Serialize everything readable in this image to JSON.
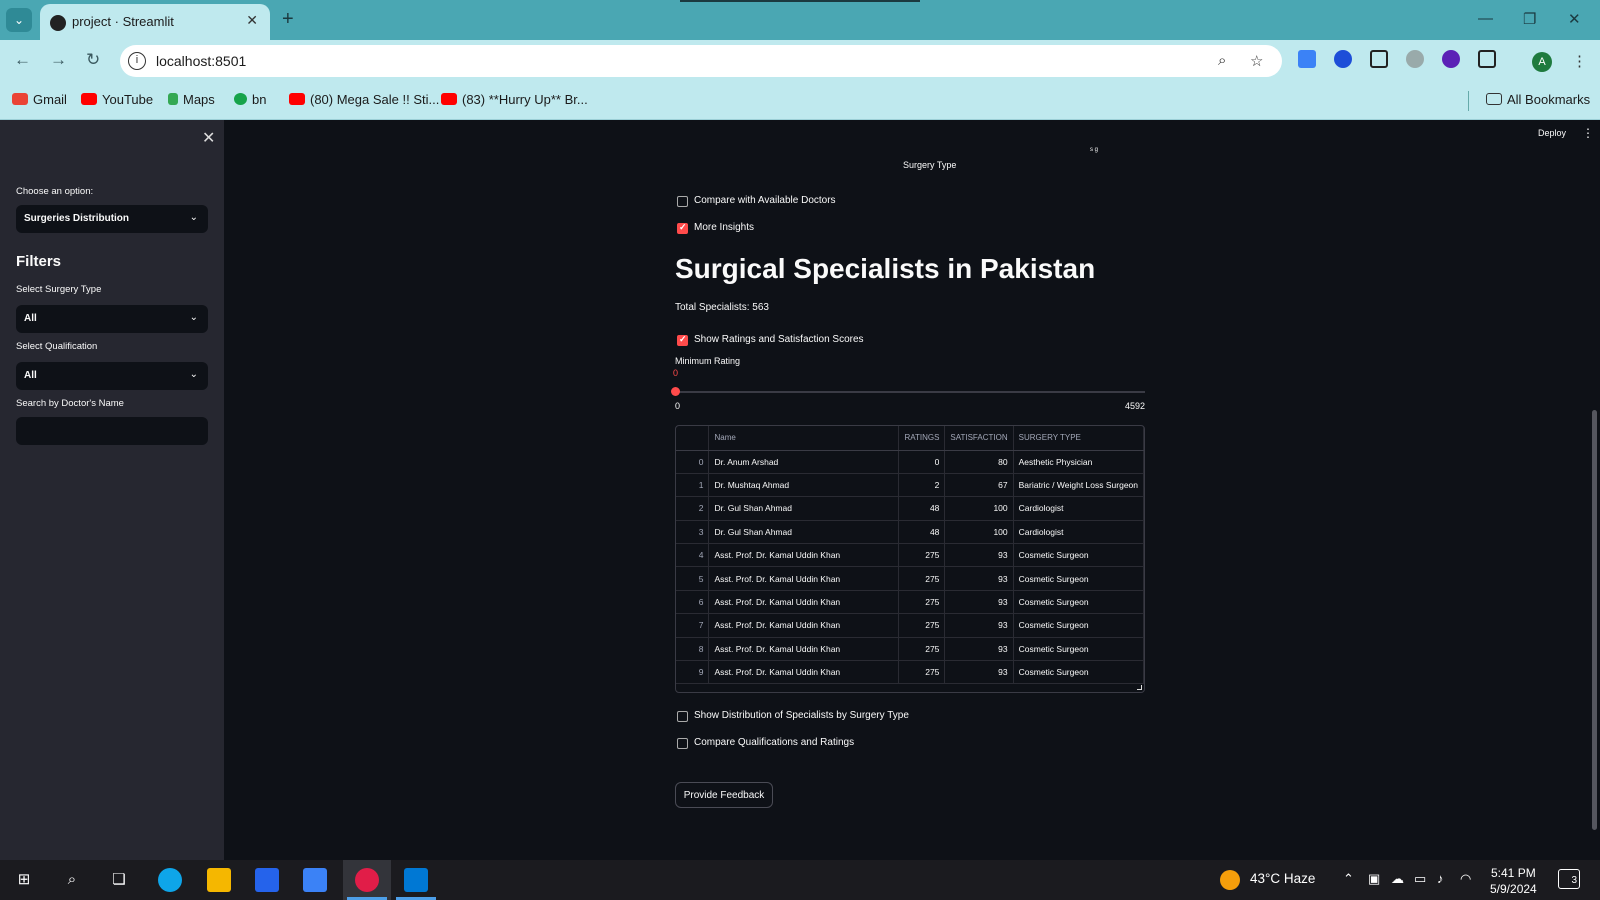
{
  "browser": {
    "tab_title": "project · Streamlit",
    "url": "localhost:8501",
    "bookmarks": [
      "Gmail",
      "YouTube",
      "Maps",
      "bn",
      "(80) Mega Sale !! Sti...",
      "(83) **Hurry Up** Br..."
    ],
    "all_bookmarks": "All Bookmarks",
    "profile_initial": "A"
  },
  "sidebar": {
    "choose_label": "Choose an option:",
    "choose_value": "Surgeries Distribution",
    "filters_heading": "Filters",
    "surgery_type_label": "Select Surgery Type",
    "surgery_type_value": "All",
    "qualification_label": "Select Qualification",
    "qualification_value": "All",
    "search_label": "Search by Doctor's Name",
    "search_value": ""
  },
  "header": {
    "deploy": "Deploy"
  },
  "main": {
    "chart_axis_title": "Surgery Type",
    "chart_axis_fragment": "s   g",
    "compare_doctors": "Compare with Available Doctors",
    "compare_doctors_checked": false,
    "more_insights": "More Insights",
    "more_insights_checked": true,
    "title": "Surgical Specialists in Pakistan",
    "total": "Total Specialists: 563",
    "show_ratings": "Show Ratings and Satisfaction Scores",
    "show_ratings_checked": true,
    "slider_label": "Minimum Rating",
    "slider_value": "0",
    "slider_min": "0",
    "slider_max": "4592",
    "table": {
      "columns": [
        "",
        "Name",
        "RATINGS",
        "SATISFACTION",
        "SURGERY TYPE"
      ],
      "rows": [
        [
          "0",
          "Dr. Anum Arshad",
          "0",
          "80",
          "Aesthetic Physician"
        ],
        [
          "1",
          "Dr. Mushtaq Ahmad",
          "2",
          "67",
          "Bariatric / Weight Loss Surgeon"
        ],
        [
          "2",
          "Dr. Gul Shan Ahmad",
          "48",
          "100",
          "Cardiologist"
        ],
        [
          "3",
          "Dr. Gul Shan Ahmad",
          "48",
          "100",
          "Cardiologist"
        ],
        [
          "4",
          "Asst. Prof. Dr. Kamal Uddin Khan",
          "275",
          "93",
          "Cosmetic Surgeon"
        ],
        [
          "5",
          "Asst. Prof. Dr. Kamal Uddin Khan",
          "275",
          "93",
          "Cosmetic Surgeon"
        ],
        [
          "6",
          "Asst. Prof. Dr. Kamal Uddin Khan",
          "275",
          "93",
          "Cosmetic Surgeon"
        ],
        [
          "7",
          "Asst. Prof. Dr. Kamal Uddin Khan",
          "275",
          "93",
          "Cosmetic Surgeon"
        ],
        [
          "8",
          "Asst. Prof. Dr. Kamal Uddin Khan",
          "275",
          "93",
          "Cosmetic Surgeon"
        ],
        [
          "9",
          "Asst. Prof. Dr. Kamal Uddin Khan",
          "275",
          "93",
          "Cosmetic Surgeon"
        ]
      ]
    },
    "show_distribution": "Show Distribution of Specialists by Surgery Type",
    "show_distribution_checked": false,
    "compare_qualifications": "Compare Qualifications and Ratings",
    "compare_qualifications_checked": false,
    "feedback_button": "Provide Feedback"
  },
  "taskbar": {
    "weather": "43°C  Haze",
    "time": "5:41 PM",
    "date": "5/9/2024",
    "notifications": "3"
  },
  "colors": {
    "accent": "#ff4b4b",
    "app_bg": "#0e1117",
    "sidebar_bg": "#262730",
    "browser_tab_bar": "#4aa7b3",
    "browser_toolbar": "#bfe9ee"
  }
}
